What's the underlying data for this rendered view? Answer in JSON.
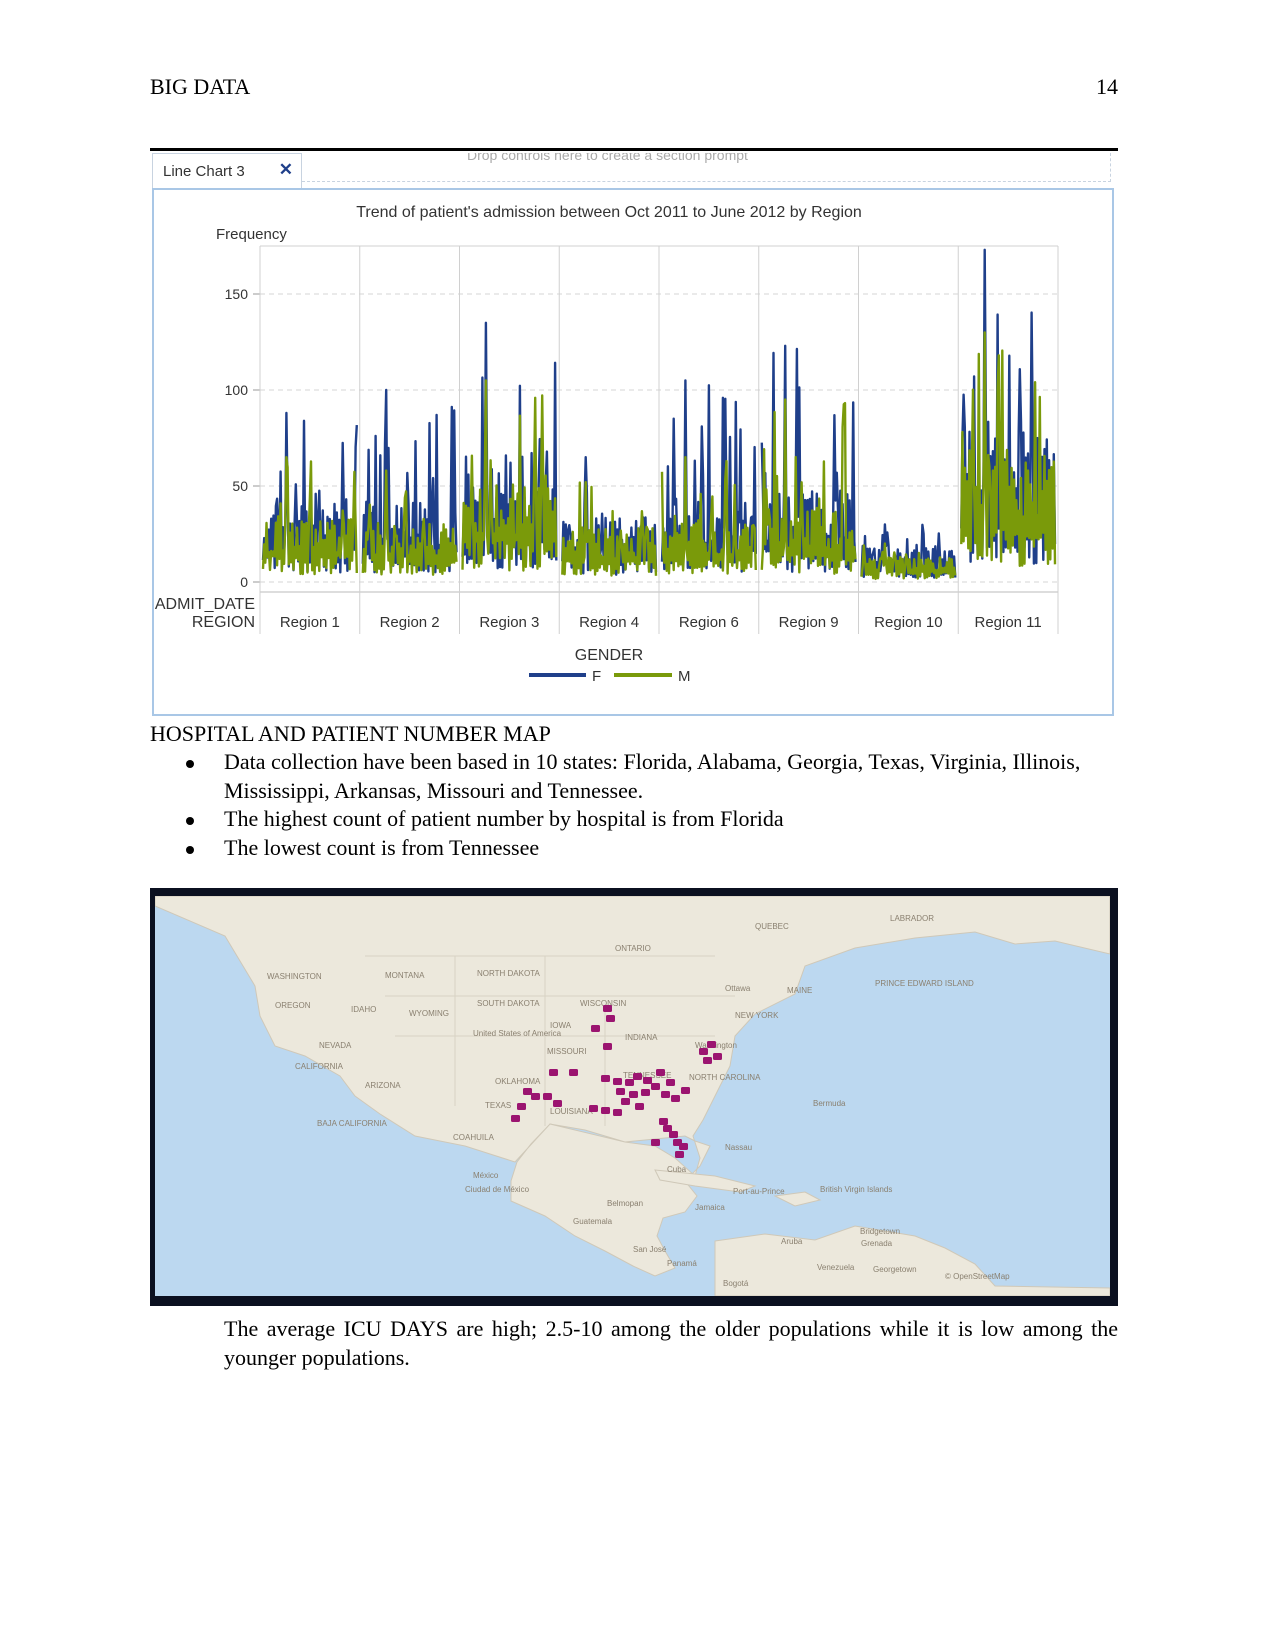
{
  "header": {
    "title": "BIG DATA",
    "page_number": "14"
  },
  "chart_panel": {
    "tab_label": "Line Chart 3",
    "close_glyph": "✕",
    "drop_hint": "Drop controls here to create a section prompt",
    "accent_border": "#a9c7e6"
  },
  "chart_data": {
    "type": "line",
    "title": "Trend of patient's admission between Oct 2011 to June 2012 by Region",
    "ylabel": "Frequency",
    "xlabel_lines": [
      "ADMIT_DATE",
      "REGION"
    ],
    "ylim": [
      0,
      175
    ],
    "yticks": [
      0,
      50,
      100,
      150
    ],
    "grid": true,
    "panels": [
      "Region 1",
      "Region 2",
      "Region 3",
      "Region 4",
      "Region 6",
      "Region 9",
      "Region 10",
      "Region 11"
    ],
    "legend": {
      "title": "GENDER",
      "placement": "bottom"
    },
    "series": [
      {
        "name": "F",
        "color": "#1f3f8a",
        "baseline": [
          33,
          30,
          48,
          25,
          30,
          35,
          14,
          60
        ],
        "peaks": [
          88,
          100,
          135,
          65,
          105,
          123,
          30,
          173
        ]
      },
      {
        "name": "M",
        "color": "#7a9a0a",
        "baseline": [
          25,
          22,
          40,
          20,
          22,
          28,
          10,
          50
        ],
        "peaks": [
          65,
          58,
          105,
          52,
          65,
          95,
          20,
          130
        ]
      }
    ]
  },
  "section": {
    "title": "HOSPITAL AND PATIENT NUMBER MAP",
    "bullets": [
      "Data collection have been based in 10 states: Florida, Alabama, Georgia, Texas, Virginia, Illinois, Mississippi, Arkansas, Missouri and Tennessee.",
      "The highest count of patient number by hospital is from Florida",
      "The lowest count is from Tennessee"
    ]
  },
  "map": {
    "water_color": "#bcd8f0",
    "land_color": "#ece8dc",
    "marker_color": "#9b1470",
    "labels": {
      "quebec": "QUEBEC",
      "labrador": "LABRADOR",
      "ontario": "ONTARIO",
      "washington_state": "WASHINGTON",
      "montana": "MONTANA",
      "north_dakota": "NORTH DAKOTA",
      "oregon": "OREGON",
      "idaho": "IDAHO",
      "wyoming": "WYOMING",
      "south_dakota": "SOUTH DAKOTA",
      "wisconsin": "WISCONSIN",
      "ottawa": "Ottawa",
      "maine": "MAINE",
      "new_york": "NEW YORK",
      "pei": "PRINCE EDWARD ISLAND",
      "iowa": "IOWA",
      "indiana": "INDIANA",
      "nevada": "NEVADA",
      "united_states": "United States of America",
      "missouri": "MISSOURI",
      "washington_dc": "Washington",
      "california": "CALIFORNIA",
      "arizona": "ARIZONA",
      "oklahoma": "OKLAHOMA",
      "tennessee": "TENNESSEE",
      "north_carolina": "NORTH CAROLINA",
      "texas": "TEXAS",
      "louisiana": "LOUISIANA",
      "bermuda": "Bermuda",
      "baja_california": "BAJA CALIFORNIA",
      "coahuila": "COAHUILA",
      "nassau": "Nassau",
      "cuba": "Cuba",
      "mexico": "México",
      "ciudad_de_mexico": "Ciudad de México",
      "port_au_prince": "Port-au-Prince",
      "british_virgin_islands": "British Virgin Islands",
      "jamaica": "Jamaica",
      "belmopan": "Belmopan",
      "guatemala": "Guatemala",
      "bridgetown": "Bridgetown",
      "grenada": "Grenada",
      "aruba": "Aruba",
      "san_jose": "San José",
      "panama": "Panamá",
      "venezuela": "Venezuela",
      "georgetown": "Georgetown",
      "bogota": "Bogotá",
      "attribution": "© OpenStreetMap"
    }
  },
  "closing_text": "The average ICU DAYS are high; 2.5-10 among the older populations while it is low among the younger populations."
}
